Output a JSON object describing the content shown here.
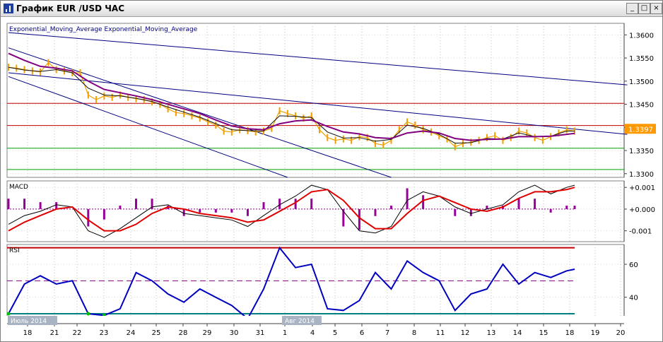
{
  "window": {
    "title": "График EUR /USD  ЧАС",
    "min_glyph": "_",
    "max_glyph": "□",
    "close_glyph": "×"
  },
  "colors": {
    "price": "#f0a000",
    "ema_fast": "#101010",
    "ema_slow": "#800080",
    "trend": "#000080",
    "resistance": "#c00000",
    "support": "#00a000",
    "macd": "#000000",
    "signal": "#e00000",
    "hist": "#990099",
    "rsi": "#0000c0",
    "rsi_low": "#00c000",
    "price_tag": "#ff9900"
  },
  "chart_data": [
    {
      "type": "line",
      "legend": "Exponential_Moving_Average Exponential_Moving_Average",
      "ylim": [
        1.3292,
        1.3625
      ],
      "yticks": [
        "1.3600",
        "1.3550",
        "1.3500",
        "1.3450",
        "1.3400",
        "1.3350",
        "1.3300"
      ],
      "last_price": "1.3397",
      "resistance_levels": [
        1.3452,
        1.3404
      ],
      "support_levels": [
        1.3355,
        1.3309
      ],
      "price_series": [
        [
          0,
          1.353
        ],
        [
          0.5,
          1.3528
        ],
        [
          1,
          1.3525
        ],
        [
          1.5,
          1.3522
        ],
        [
          2,
          1.352
        ],
        [
          2.5,
          1.354
        ],
        [
          3,
          1.3525
        ],
        [
          3.5,
          1.3522
        ],
        [
          4,
          1.3518
        ],
        [
          4.5,
          1.3518
        ],
        [
          5,
          1.347
        ],
        [
          5.5,
          1.346
        ],
        [
          6,
          1.3468
        ],
        [
          6.5,
          1.3465
        ],
        [
          7,
          1.347
        ],
        [
          7.5,
          1.3465
        ],
        [
          8,
          1.3462
        ],
        [
          8.5,
          1.346
        ],
        [
          9,
          1.3455
        ],
        [
          9.5,
          1.345
        ],
        [
          10,
          1.344
        ],
        [
          10.5,
          1.3432
        ],
        [
          11,
          1.343
        ],
        [
          11.5,
          1.3425
        ],
        [
          12,
          1.342
        ],
        [
          12.5,
          1.3412
        ],
        [
          13,
          1.3405
        ],
        [
          13.5,
          1.3392
        ],
        [
          14,
          1.339
        ],
        [
          14.5,
          1.3395
        ],
        [
          15,
          1.3393
        ],
        [
          15.5,
          1.339
        ],
        [
          16,
          1.3392
        ],
        [
          16.5,
          1.3398
        ],
        [
          17,
          1.3436
        ],
        [
          17.5,
          1.343
        ],
        [
          18,
          1.3425
        ],
        [
          18.5,
          1.342
        ],
        [
          19,
          1.3425
        ],
        [
          19.5,
          1.3395
        ],
        [
          20,
          1.3378
        ],
        [
          20.5,
          1.3372
        ],
        [
          21,
          1.3375
        ],
        [
          21.5,
          1.3372
        ],
        [
          22,
          1.338
        ],
        [
          22.5,
          1.3378
        ],
        [
          23,
          1.3365
        ],
        [
          23.5,
          1.3362
        ],
        [
          24,
          1.3372
        ],
        [
          24.5,
          1.3395
        ],
        [
          25,
          1.3412
        ],
        [
          25.5,
          1.3405
        ],
        [
          26,
          1.3395
        ],
        [
          26.5,
          1.339
        ],
        [
          27,
          1.3382
        ],
        [
          27.5,
          1.3375
        ],
        [
          28,
          1.3358
        ],
        [
          28.5,
          1.3365
        ],
        [
          29,
          1.3368
        ],
        [
          29.5,
          1.3372
        ],
        [
          30,
          1.3378
        ],
        [
          30.5,
          1.3382
        ],
        [
          31,
          1.3372
        ],
        [
          31.5,
          1.3378
        ],
        [
          32,
          1.3392
        ],
        [
          32.5,
          1.3388
        ],
        [
          33,
          1.3378
        ],
        [
          33.5,
          1.3372
        ],
        [
          34,
          1.338
        ],
        [
          34.5,
          1.3388
        ],
        [
          35,
          1.3395
        ],
        [
          35.5,
          1.3392
        ]
      ],
      "ema_fast": [
        [
          0,
          1.353
        ],
        [
          1,
          1.3524
        ],
        [
          2,
          1.3521
        ],
        [
          3,
          1.3525
        ],
        [
          4,
          1.3518
        ],
        [
          5,
          1.3485
        ],
        [
          6,
          1.347
        ],
        [
          7,
          1.3468
        ],
        [
          8,
          1.3463
        ],
        [
          9,
          1.3456
        ],
        [
          10,
          1.3444
        ],
        [
          11,
          1.3433
        ],
        [
          12,
          1.3422
        ],
        [
          13,
          1.3408
        ],
        [
          14,
          1.3395
        ],
        [
          15,
          1.3393
        ],
        [
          16,
          1.3392
        ],
        [
          17,
          1.3425
        ],
        [
          18,
          1.3424
        ],
        [
          19,
          1.3421
        ],
        [
          20,
          1.339
        ],
        [
          21,
          1.3377
        ],
        [
          22,
          1.3378
        ],
        [
          23,
          1.337
        ],
        [
          24,
          1.3374
        ],
        [
          25,
          1.3405
        ],
        [
          26,
          1.3398
        ],
        [
          27,
          1.3385
        ],
        [
          28,
          1.3366
        ],
        [
          29,
          1.3367
        ],
        [
          30,
          1.3376
        ],
        [
          31,
          1.3375
        ],
        [
          32,
          1.3388
        ],
        [
          33,
          1.338
        ],
        [
          34,
          1.3381
        ],
        [
          35,
          1.3392
        ],
        [
          35.5,
          1.3392
        ]
      ],
      "ema_slow": [
        [
          0,
          1.356
        ],
        [
          1,
          1.3545
        ],
        [
          2,
          1.3532
        ],
        [
          3,
          1.3528
        ],
        [
          4,
          1.3522
        ],
        [
          5,
          1.35
        ],
        [
          6,
          1.3482
        ],
        [
          7,
          1.3475
        ],
        [
          8,
          1.3468
        ],
        [
          9,
          1.346
        ],
        [
          10,
          1.345
        ],
        [
          11,
          1.344
        ],
        [
          12,
          1.343
        ],
        [
          13,
          1.3416
        ],
        [
          14,
          1.3403
        ],
        [
          15,
          1.3397
        ],
        [
          16,
          1.3395
        ],
        [
          17,
          1.3408
        ],
        [
          18,
          1.3414
        ],
        [
          19,
          1.3416
        ],
        [
          20,
          1.3402
        ],
        [
          21,
          1.339
        ],
        [
          22,
          1.3386
        ],
        [
          23,
          1.3378
        ],
        [
          24,
          1.3376
        ],
        [
          25,
          1.3388
        ],
        [
          26,
          1.3392
        ],
        [
          27,
          1.3388
        ],
        [
          28,
          1.3376
        ],
        [
          29,
          1.3372
        ],
        [
          30,
          1.3374
        ],
        [
          31,
          1.3375
        ],
        [
          32,
          1.338
        ],
        [
          33,
          1.338
        ],
        [
          34,
          1.3381
        ],
        [
          35,
          1.3385
        ],
        [
          35.5,
          1.3387
        ]
      ],
      "trendlines": [
        [
          [
            0,
            1.3605
          ],
          [
            38.8,
            1.3492
          ]
        ],
        [
          [
            0,
            1.3572
          ],
          [
            24.0,
            1.3292
          ]
        ],
        [
          [
            0,
            1.351
          ],
          [
            17.5,
            1.3292
          ]
        ],
        [
          [
            0,
            1.3518
          ],
          [
            38.8,
            1.3385
          ]
        ]
      ]
    },
    {
      "type": "line",
      "legend": "MACD",
      "ylim": [
        -0.0015,
        0.0013
      ],
      "yticks": [
        "+0.001",
        "+0.000",
        "-0.001"
      ],
      "macd": [
        [
          0,
          -0.0007
        ],
        [
          1,
          -0.0003
        ],
        [
          2,
          -0.0001
        ],
        [
          3,
          0.0002
        ],
        [
          4,
          0.0001
        ],
        [
          5,
          -0.001
        ],
        [
          6,
          -0.0013
        ],
        [
          7,
          -0.0009
        ],
        [
          8,
          -0.0004
        ],
        [
          9,
          0.0001
        ],
        [
          10,
          0.0002
        ],
        [
          11,
          -0.0002
        ],
        [
          12,
          -0.0003
        ],
        [
          13,
          -0.0004
        ],
        [
          14,
          -0.0005
        ],
        [
          15,
          -0.0008
        ],
        [
          16,
          -0.0003
        ],
        [
          17,
          0.0002
        ],
        [
          18,
          0.0006
        ],
        [
          19,
          0.0011
        ],
        [
          20,
          0.0009
        ],
        [
          21,
          -0.0001
        ],
        [
          22,
          -0.001
        ],
        [
          23,
          -0.0011
        ],
        [
          24,
          -0.0008
        ],
        [
          25,
          0.0004
        ],
        [
          26,
          0.0008
        ],
        [
          27,
          0.0006
        ],
        [
          28,
          0.0001
        ],
        [
          29,
          -0.0002
        ],
        [
          30,
          0.0
        ],
        [
          31,
          0.0002
        ],
        [
          32,
          0.0008
        ],
        [
          33,
          0.0011
        ],
        [
          34,
          0.0007
        ],
        [
          35,
          0.001
        ],
        [
          35.5,
          0.0011
        ]
      ],
      "signal": [
        [
          0,
          -0.001
        ],
        [
          1,
          -0.0006
        ],
        [
          2,
          -0.0003
        ],
        [
          3,
          0.0
        ],
        [
          4,
          0.0001
        ],
        [
          5,
          -0.0005
        ],
        [
          6,
          -0.001
        ],
        [
          7,
          -0.001
        ],
        [
          8,
          -0.0007
        ],
        [
          9,
          -0.0002
        ],
        [
          10,
          0.0001
        ],
        [
          11,
          0.0
        ],
        [
          12,
          -0.0002
        ],
        [
          13,
          -0.0003
        ],
        [
          14,
          -0.0004
        ],
        [
          15,
          -0.0006
        ],
        [
          16,
          -0.0005
        ],
        [
          17,
          -0.0001
        ],
        [
          18,
          0.0003
        ],
        [
          19,
          0.0008
        ],
        [
          20,
          0.0009
        ],
        [
          21,
          0.0004
        ],
        [
          22,
          -0.0004
        ],
        [
          23,
          -0.0009
        ],
        [
          24,
          -0.0009
        ],
        [
          25,
          -0.0002
        ],
        [
          26,
          0.0004
        ],
        [
          27,
          0.0006
        ],
        [
          28,
          0.0003
        ],
        [
          29,
          0.0
        ],
        [
          30,
          -0.0001
        ],
        [
          31,
          0.0001
        ],
        [
          32,
          0.0005
        ],
        [
          33,
          0.0008
        ],
        [
          34,
          0.0008
        ],
        [
          35,
          0.0009
        ],
        [
          35.5,
          0.001
        ]
      ]
    },
    {
      "type": "line",
      "legend": "RSI",
      "ylim": [
        24,
        72
      ],
      "yticks": [
        "60",
        "40"
      ],
      "upper_level": 70,
      "lower_level": 30,
      "mid_level": 50,
      "rsi": [
        [
          0,
          30
        ],
        [
          1,
          48
        ],
        [
          2,
          53
        ],
        [
          3,
          48
        ],
        [
          4,
          50
        ],
        [
          5,
          30
        ],
        [
          6,
          29
        ],
        [
          7,
          33
        ],
        [
          8,
          55
        ],
        [
          9,
          50
        ],
        [
          10,
          42
        ],
        [
          11,
          37
        ],
        [
          12,
          45
        ],
        [
          13,
          40
        ],
        [
          14,
          35
        ],
        [
          15,
          27
        ],
        [
          16,
          45
        ],
        [
          17,
          70
        ],
        [
          18,
          58
        ],
        [
          19,
          60
        ],
        [
          20,
          33
        ],
        [
          21,
          32
        ],
        [
          22,
          38
        ],
        [
          23,
          55
        ],
        [
          24,
          45
        ],
        [
          25,
          62
        ],
        [
          26,
          55
        ],
        [
          27,
          50
        ],
        [
          28,
          32
        ],
        [
          29,
          42
        ],
        [
          30,
          45
        ],
        [
          31,
          60
        ],
        [
          32,
          48
        ],
        [
          33,
          55
        ],
        [
          34,
          52
        ],
        [
          35,
          56
        ],
        [
          35.5,
          57
        ]
      ]
    }
  ],
  "x_axis": {
    "day_labels": [
      "18",
      "21",
      "22",
      "23",
      "24",
      "25",
      "28",
      "29",
      "30",
      "31",
      "1",
      "4",
      "5",
      "6",
      "7",
      "8",
      "11",
      "12",
      "13",
      "14",
      "15",
      "18",
      "19",
      "20"
    ],
    "month_labels": [
      "Июль 2014",
      "Авг 2014"
    ]
  }
}
